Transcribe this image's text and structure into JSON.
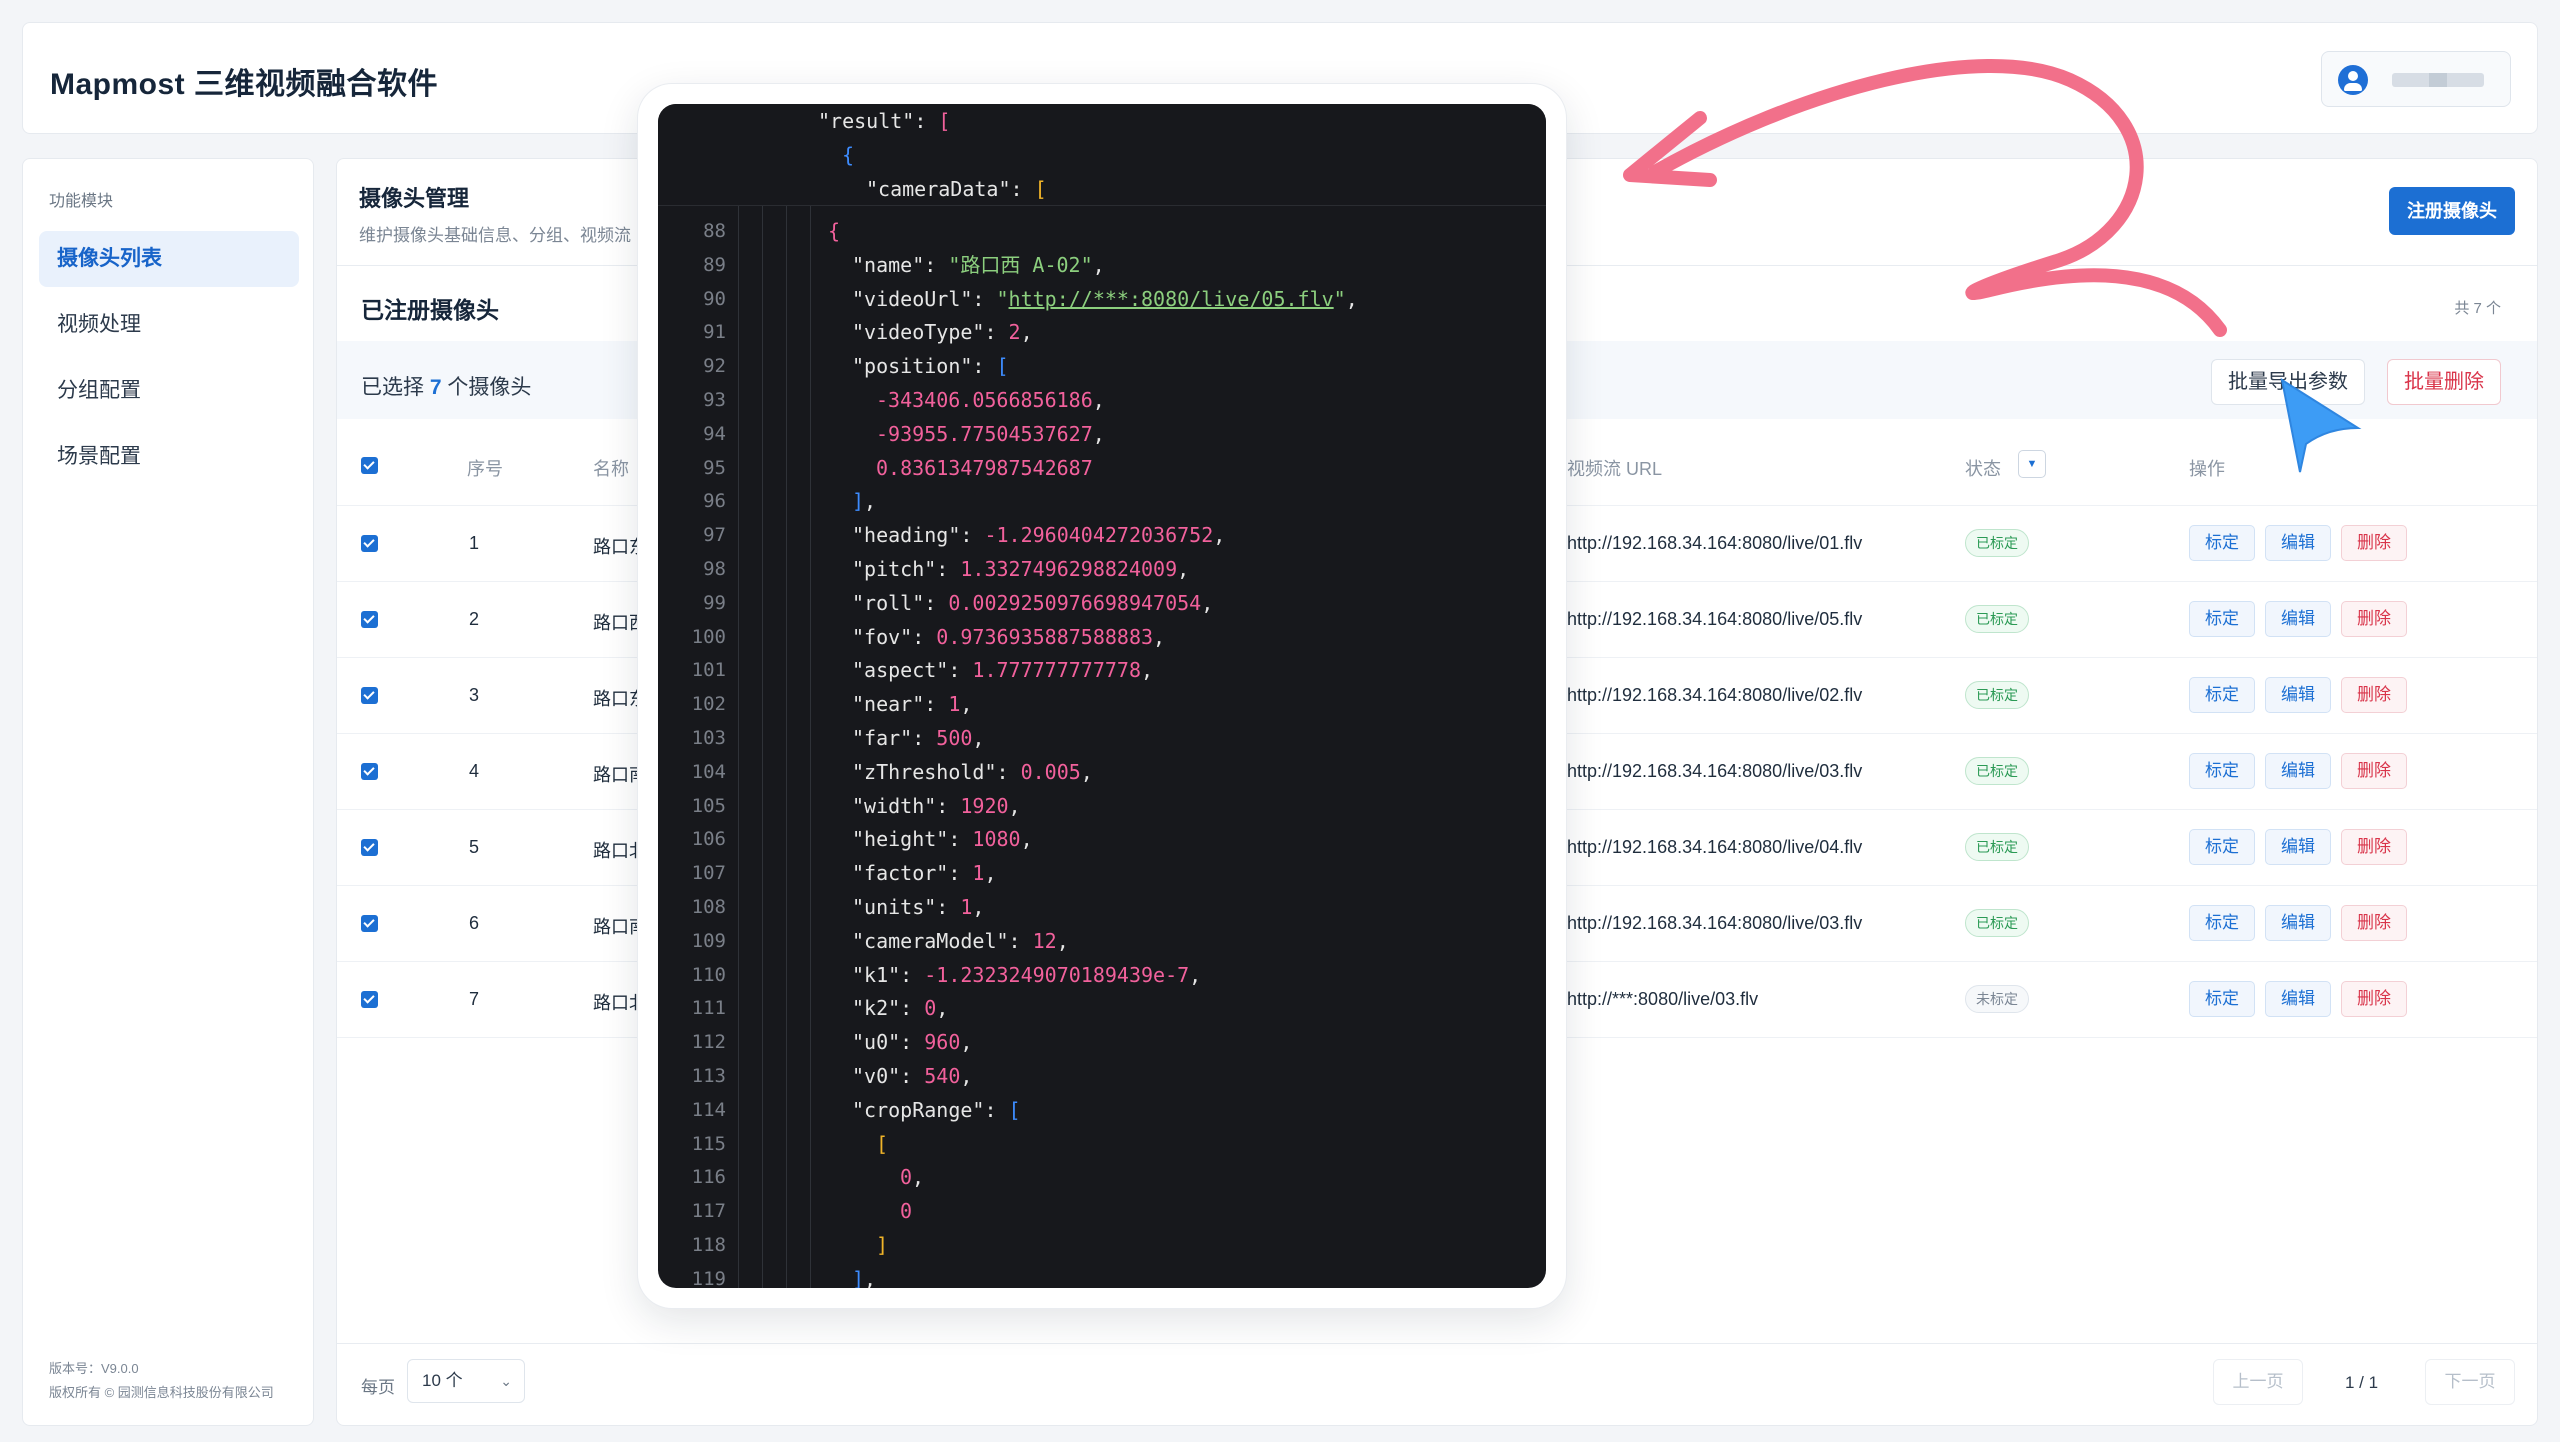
{
  "app": {
    "title": "Mapmost 三维视频融合软件"
  },
  "sidebar": {
    "caption": "功能模块",
    "items": [
      {
        "label": "摄像头列表",
        "active": true
      },
      {
        "label": "视频处理",
        "active": false
      },
      {
        "label": "分组配置",
        "active": false
      },
      {
        "label": "场景配置",
        "active": false
      }
    ],
    "footer": {
      "version": "版本号：V9.0.0",
      "copyright": "版权所有 © 园测信息科技股份有限公司"
    }
  },
  "section": {
    "title": "摄像头管理",
    "description": "维护摄像头基础信息、分组、视频流",
    "register_button": "注册摄像头"
  },
  "list": {
    "title": "已注册摄像头",
    "total": "共 7 个",
    "selected_prefix": "已选择",
    "selected_count": "7",
    "selected_suffix": "个摄像头",
    "export_button": "批量导出参数",
    "delete_button": "批量删除",
    "columns": {
      "index": "序号",
      "name": "名称",
      "url": "视频流 URL",
      "status": "状态",
      "actions": "操作"
    },
    "actions": {
      "calibrate": "标定",
      "edit": "编辑",
      "delete": "删除"
    },
    "rows": [
      {
        "index": "1",
        "name": "路口东",
        "url": "http://192.168.34.164:8080/live/01.flv",
        "status": "已标定",
        "calibrated": true
      },
      {
        "index": "2",
        "name": "路口西",
        "url": "http://192.168.34.164:8080/live/05.flv",
        "status": "已标定",
        "calibrated": true
      },
      {
        "index": "3",
        "name": "路口东",
        "url": "http://192.168.34.164:8080/live/02.flv",
        "status": "已标定",
        "calibrated": true
      },
      {
        "index": "4",
        "name": "路口南",
        "url": "http://192.168.34.164:8080/live/03.flv",
        "status": "已标定",
        "calibrated": true
      },
      {
        "index": "5",
        "name": "路口北",
        "url": "http://192.168.34.164:8080/live/04.flv",
        "status": "已标定",
        "calibrated": true
      },
      {
        "index": "6",
        "name": "路口南",
        "url": "http://192.168.34.164:8080/live/03.flv",
        "status": "已标定",
        "calibrated": true
      },
      {
        "index": "7",
        "name": "路口北",
        "url": "http://***:8080/live/03.flv",
        "status": "未标定",
        "calibrated": false
      }
    ]
  },
  "pager": {
    "per_page_label": "每页",
    "per_page_value": "10 个",
    "prev": "上一页",
    "page_info": "1 / 1",
    "next": "下一页"
  },
  "code": {
    "header_lines": [
      [
        [
          "k",
          "\"result\": "
        ],
        [
          "b1",
          "["
        ]
      ],
      [
        [
          "b2",
          "{"
        ]
      ],
      [
        [
          "k",
          "\"cameraData\": "
        ],
        [
          "b3",
          "["
        ]
      ]
    ],
    "lines": [
      {
        "no": "88",
        "indent": 4,
        "tokens": [
          [
            "b1",
            "{"
          ]
        ]
      },
      {
        "no": "89",
        "indent": 5,
        "tokens": [
          [
            "k",
            "\"name\": "
          ],
          [
            "s",
            "\"路口西 A-02\""
          ],
          [
            "k",
            ","
          ]
        ]
      },
      {
        "no": "90",
        "indent": 5,
        "tokens": [
          [
            "k",
            "\"videoUrl\": "
          ],
          [
            "s",
            "\""
          ],
          [
            "u",
            "http://***:8080/live/05.flv"
          ],
          [
            "s",
            "\""
          ],
          [
            "k",
            ","
          ]
        ]
      },
      {
        "no": "91",
        "indent": 5,
        "tokens": [
          [
            "k",
            "\"videoType\": "
          ],
          [
            "n",
            "2"
          ],
          [
            "k",
            ","
          ]
        ]
      },
      {
        "no": "92",
        "indent": 5,
        "tokens": [
          [
            "k",
            "\"position\": "
          ],
          [
            "b2",
            "["
          ]
        ]
      },
      {
        "no": "93",
        "indent": 6,
        "tokens": [
          [
            "n",
            "-343406.0566856186"
          ],
          [
            "k",
            ","
          ]
        ]
      },
      {
        "no": "94",
        "indent": 6,
        "tokens": [
          [
            "n",
            "-93955.77504537627"
          ],
          [
            "k",
            ","
          ]
        ]
      },
      {
        "no": "95",
        "indent": 6,
        "tokens": [
          [
            "n",
            "0.8361347987542687"
          ]
        ]
      },
      {
        "no": "96",
        "indent": 5,
        "tokens": [
          [
            "b2",
            "]"
          ],
          [
            "k",
            ","
          ]
        ]
      },
      {
        "no": "97",
        "indent": 5,
        "tokens": [
          [
            "k",
            "\"heading\": "
          ],
          [
            "n",
            "-1.2960404272036752"
          ],
          [
            "k",
            ","
          ]
        ]
      },
      {
        "no": "98",
        "indent": 5,
        "tokens": [
          [
            "k",
            "\"pitch\": "
          ],
          [
            "n",
            "1.3327496298824009"
          ],
          [
            "k",
            ","
          ]
        ]
      },
      {
        "no": "99",
        "indent": 5,
        "tokens": [
          [
            "k",
            "\"roll\": "
          ],
          [
            "n",
            "0.0029250976698947054"
          ],
          [
            "k",
            ","
          ]
        ]
      },
      {
        "no": "100",
        "indent": 5,
        "tokens": [
          [
            "k",
            "\"fov\": "
          ],
          [
            "n",
            "0.9736935887588883"
          ],
          [
            "k",
            ","
          ]
        ]
      },
      {
        "no": "101",
        "indent": 5,
        "tokens": [
          [
            "k",
            "\"aspect\": "
          ],
          [
            "n",
            "1.777777777778"
          ],
          [
            "k",
            ","
          ]
        ]
      },
      {
        "no": "102",
        "indent": 5,
        "tokens": [
          [
            "k",
            "\"near\": "
          ],
          [
            "n",
            "1"
          ],
          [
            "k",
            ","
          ]
        ]
      },
      {
        "no": "103",
        "indent": 5,
        "tokens": [
          [
            "k",
            "\"far\": "
          ],
          [
            "n",
            "500"
          ],
          [
            "k",
            ","
          ]
        ]
      },
      {
        "no": "104",
        "indent": 5,
        "tokens": [
          [
            "k",
            "\"zThreshold\": "
          ],
          [
            "n",
            "0.005"
          ],
          [
            "k",
            ","
          ]
        ]
      },
      {
        "no": "105",
        "indent": 5,
        "tokens": [
          [
            "k",
            "\"width\": "
          ],
          [
            "n",
            "1920"
          ],
          [
            "k",
            ","
          ]
        ]
      },
      {
        "no": "106",
        "indent": 5,
        "tokens": [
          [
            "k",
            "\"height\": "
          ],
          [
            "n",
            "1080"
          ],
          [
            "k",
            ","
          ]
        ]
      },
      {
        "no": "107",
        "indent": 5,
        "tokens": [
          [
            "k",
            "\"factor\": "
          ],
          [
            "n",
            "1"
          ],
          [
            "k",
            ","
          ]
        ]
      },
      {
        "no": "108",
        "indent": 5,
        "tokens": [
          [
            "k",
            "\"units\": "
          ],
          [
            "n",
            "1"
          ],
          [
            "k",
            ","
          ]
        ]
      },
      {
        "no": "109",
        "indent": 5,
        "tokens": [
          [
            "k",
            "\"cameraModel\": "
          ],
          [
            "n",
            "12"
          ],
          [
            "k",
            ","
          ]
        ]
      },
      {
        "no": "110",
        "indent": 5,
        "tokens": [
          [
            "k",
            "\"k1\": "
          ],
          [
            "n",
            "-1.2323249070189439e-7"
          ],
          [
            "k",
            ","
          ]
        ]
      },
      {
        "no": "111",
        "indent": 5,
        "tokens": [
          [
            "k",
            "\"k2\": "
          ],
          [
            "n",
            "0"
          ],
          [
            "k",
            ","
          ]
        ]
      },
      {
        "no": "112",
        "indent": 5,
        "tokens": [
          [
            "k",
            "\"u0\": "
          ],
          [
            "n",
            "960"
          ],
          [
            "k",
            ","
          ]
        ]
      },
      {
        "no": "113",
        "indent": 5,
        "tokens": [
          [
            "k",
            "\"v0\": "
          ],
          [
            "n",
            "540"
          ],
          [
            "k",
            ","
          ]
        ]
      },
      {
        "no": "114",
        "indent": 5,
        "tokens": [
          [
            "k",
            "\"cropRange\": "
          ],
          [
            "b2",
            "["
          ]
        ]
      },
      {
        "no": "115",
        "indent": 6,
        "tokens": [
          [
            "b3",
            "["
          ]
        ]
      },
      {
        "no": "116",
        "indent": 7,
        "tokens": [
          [
            "n",
            "0"
          ],
          [
            "k",
            ","
          ]
        ]
      },
      {
        "no": "117",
        "indent": 7,
        "tokens": [
          [
            "n",
            "0"
          ]
        ]
      },
      {
        "no": "118",
        "indent": 6,
        "tokens": [
          [
            "b3",
            "]"
          ]
        ]
      },
      {
        "no": "119",
        "indent": 5,
        "tokens": [
          [
            "b2",
            "]"
          ],
          [
            "k",
            ","
          ]
        ]
      }
    ]
  },
  "colors": {
    "primary": "#1c6fd3",
    "danger": "#d9344a",
    "success": "#2b9a55",
    "code_bg": "#17181c",
    "arrow": "#f2708a",
    "cursor": "#3d9cf5"
  },
  "icons": {
    "user": "user-avatar-icon",
    "dropdown": "chevron-down-icon",
    "filter": "filter-icon",
    "checkbox": "checkbox-checked-icon",
    "cursor": "pointer-cursor-icon",
    "arrow": "curved-arrow-annotation"
  }
}
